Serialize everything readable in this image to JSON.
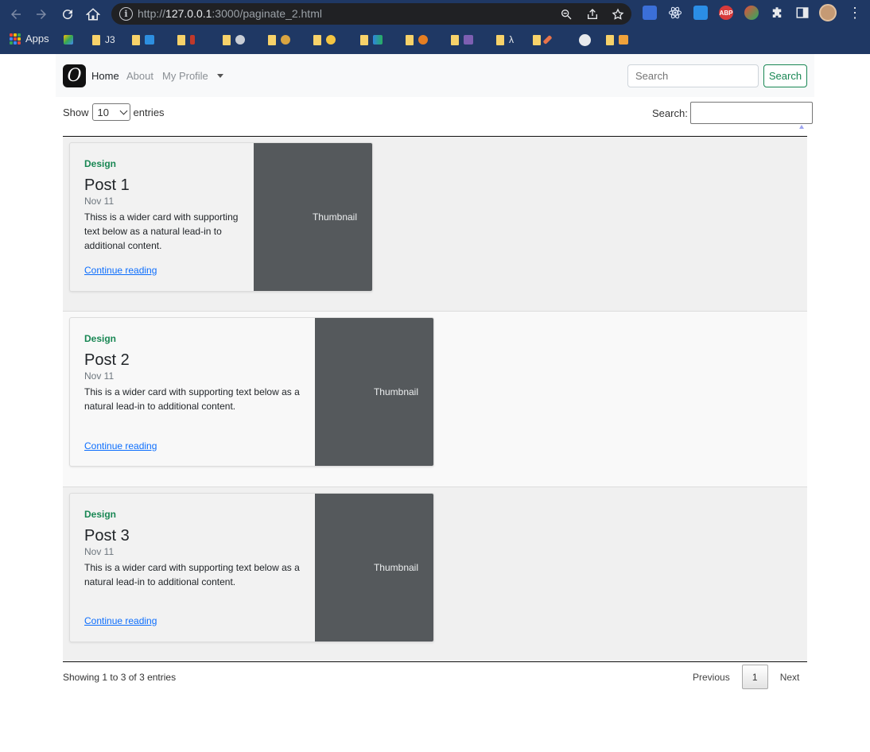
{
  "browser": {
    "url_prefix": "http://",
    "url_host": "127.0.0.1",
    "url_rest": ":3000/paginate_2.html",
    "bookmarks": {
      "apps_label": "Apps",
      "j3_label": "J3",
      "lambda_label": "λ"
    },
    "extension_abp": "ABP"
  },
  "navbar": {
    "brand_glyph": "O",
    "links": [
      "Home",
      "About",
      "My Profile"
    ],
    "search_placeholder": "Search",
    "search_button": "Search"
  },
  "datatable": {
    "show_label": "Show",
    "page_length": "10",
    "entries_label": "entries",
    "search_label": "Search:",
    "info": "Showing 1 to 3 of 3 entries",
    "previous": "Previous",
    "current_page": "1",
    "next": "Next"
  },
  "posts": [
    {
      "category": "Design",
      "title": "Post 1",
      "date": "Nov 11",
      "text": "Thiss is a wider card with supporting text below as a natural lead-in to additional content.",
      "link": "Continue reading",
      "thumbnail": "Thumbnail"
    },
    {
      "category": "Design",
      "title": "Post 2",
      "date": "Nov 11",
      "text": "This is a wider card with supporting text below as a natural lead-in to additional content.",
      "link": "Continue reading",
      "thumbnail": "Thumbnail"
    },
    {
      "category": "Design",
      "title": "Post 3",
      "date": "Nov 11",
      "text": "This is a wider card with supporting text below as a natural lead-in to additional content.",
      "link": "Continue reading",
      "thumbnail": "Thumbnail"
    }
  ],
  "colors": {
    "chrome_bg": "#1f3864",
    "accent_green": "#198754",
    "link_blue": "#0d6efd",
    "thumb_bg": "#55595c"
  }
}
